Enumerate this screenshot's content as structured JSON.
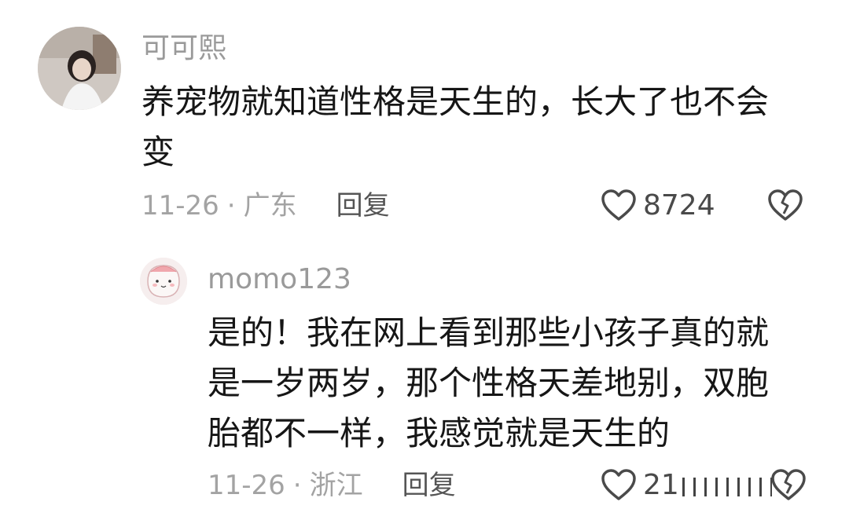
{
  "comments": [
    {
      "username": "可可熙",
      "lines": [
        "养宠物就知道性格是天生的，长大了也不会",
        "变"
      ],
      "date": "11-26",
      "separator": "·",
      "location": "广东",
      "reply_label": "回复",
      "likes": "8724",
      "like_icon": "heart-outline-icon",
      "dislike_icon": "broken-heart-icon"
    },
    {
      "username": "momo123",
      "lines": [
        "是的！我在网上看到那些小孩子真的就",
        "是一岁两岁，那个性格天差地别，双胞",
        "胎都不一样，我感觉就是天生的"
      ],
      "date": "11-26",
      "separator": "·",
      "location": "浙江",
      "reply_label": "回复",
      "likes": "21",
      "like_icon": "heart-outline-icon",
      "dislike_icon": "broken-heart-icon"
    }
  ],
  "colors": {
    "username": "#9a9a9a",
    "text": "#161616",
    "meta": "#a3a3a3",
    "icon": "#4a4a4a"
  }
}
